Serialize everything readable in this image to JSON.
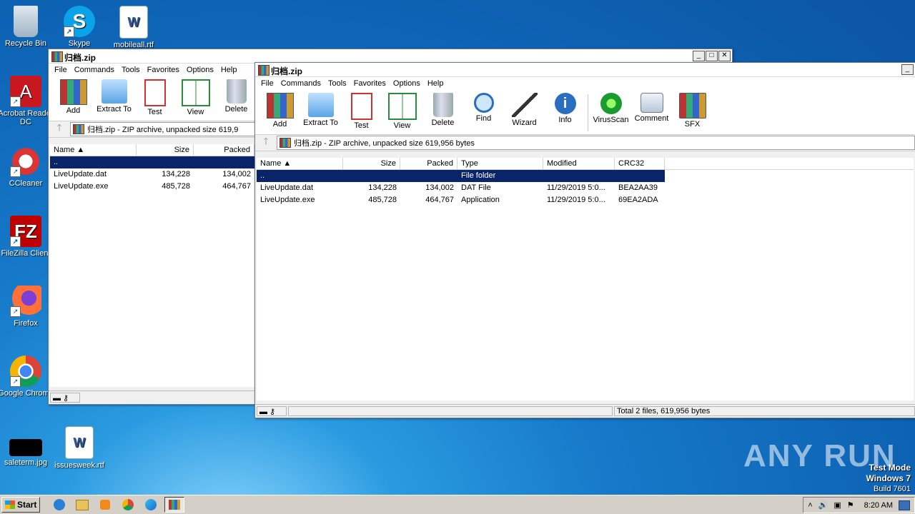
{
  "desktop_icons": [
    {
      "label": "Recycle Bin",
      "icon": "recycle-bin-icon"
    },
    {
      "label": "Skype",
      "icon": "skype-icon"
    },
    {
      "label": "mobileall.rtf",
      "icon": "word-document-icon"
    },
    {
      "label": "Acrobat Reader DC",
      "icon": "acrobat-icon"
    },
    {
      "label": "CCleaner",
      "icon": "ccleaner-icon"
    },
    {
      "label": "FileZilla Client",
      "icon": "filezilla-icon"
    },
    {
      "label": "Firefox",
      "icon": "firefox-icon"
    },
    {
      "label": "Google Chrome",
      "icon": "chrome-icon"
    },
    {
      "label": "saleterm.jpg",
      "icon": "image-file-icon"
    },
    {
      "label": "issuesweek.rtf",
      "icon": "word-document-icon"
    }
  ],
  "back_window": {
    "title": "归档.zip",
    "menu": [
      "File",
      "Commands",
      "Tools",
      "Favorites",
      "Options",
      "Help"
    ],
    "toolbar": [
      "Add",
      "Extract To",
      "Test",
      "View",
      "Delete"
    ],
    "address": "归档.zip - ZIP archive, unpacked size 619,9",
    "columns": [
      "Name",
      "Size",
      "Packed"
    ],
    "rows": [
      {
        "name": "..",
        "size": "",
        "packed": ""
      },
      {
        "name": "LiveUpdate.dat",
        "size": "134,228",
        "packed": "134,002"
      },
      {
        "name": "LiveUpdate.exe",
        "size": "485,728",
        "packed": "464,767"
      }
    ]
  },
  "front_window": {
    "title": "归档.zip",
    "menu": [
      "File",
      "Commands",
      "Tools",
      "Favorites",
      "Options",
      "Help"
    ],
    "toolbar": [
      "Add",
      "Extract To",
      "Test",
      "View",
      "Delete",
      "Find",
      "Wizard",
      "Info",
      "VirusScan",
      "Comment",
      "SFX"
    ],
    "address": "归档.zip - ZIP archive, unpacked size 619,956 bytes",
    "columns": [
      "Name",
      "Size",
      "Packed",
      "Type",
      "Modified",
      "CRC32"
    ],
    "rows": [
      {
        "name": "..",
        "size": "",
        "packed": "",
        "type": "File folder",
        "modified": "",
        "crc": ""
      },
      {
        "name": "LiveUpdate.dat",
        "size": "134,228",
        "packed": "134,002",
        "type": "DAT File",
        "modified": "11/29/2019 5:0...",
        "crc": "BEA2AA39"
      },
      {
        "name": "LiveUpdate.exe",
        "size": "485,728",
        "packed": "464,767",
        "type": "Application",
        "modified": "11/29/2019 5:0...",
        "crc": "69EA2ADA"
      }
    ],
    "status": "Total 2 files, 619,956 bytes"
  },
  "taskbar": {
    "start_label": "Start",
    "clock": "8:20 AM"
  },
  "watermark": "ANY RUN",
  "test_mode": {
    "line1": "Test Mode",
    "line2": "Windows 7",
    "line3": "Build 7601"
  }
}
